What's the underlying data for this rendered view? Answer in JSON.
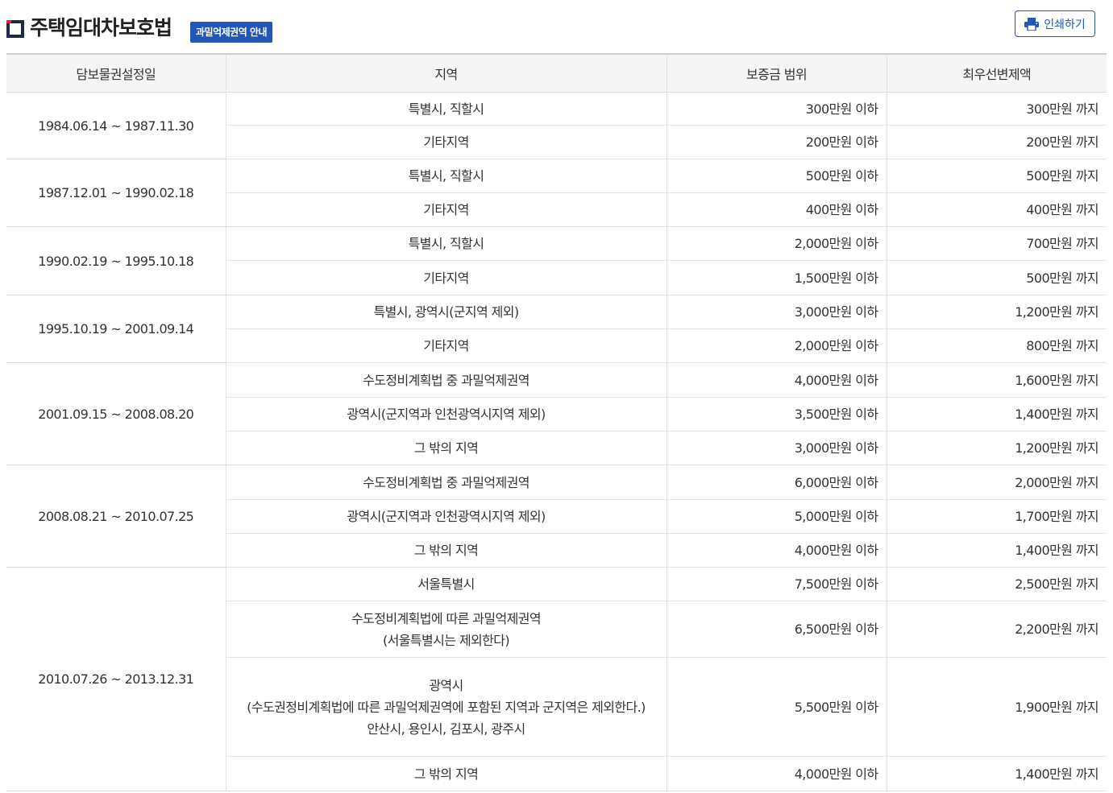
{
  "header": {
    "title": "주택임대차보호법",
    "badge": "과밀억제권역 안내",
    "print_label": "인쇄하기",
    "accent_color": "#2456b8"
  },
  "table": {
    "columns": [
      "담보물권설정일",
      "지역",
      "보증금 범위",
      "최우선변제액"
    ],
    "groups": [
      {
        "period": "1984.06.14 ~ 1987.11.30",
        "rows": [
          {
            "region": [
              "특별시, 직할시"
            ],
            "deposit": "300만원 이하",
            "priority": "300만원 까지"
          },
          {
            "region": [
              "기타지역"
            ],
            "deposit": "200만원 이하",
            "priority": "200만원 까지"
          }
        ]
      },
      {
        "period": "1987.12.01 ~ 1990.02.18",
        "rows": [
          {
            "region": [
              "특별시, 직할시"
            ],
            "deposit": "500만원 이하",
            "priority": "500만원 까지"
          },
          {
            "region": [
              "기타지역"
            ],
            "deposit": "400만원 이하",
            "priority": "400만원 까지"
          }
        ]
      },
      {
        "period": "1990.02.19 ~ 1995.10.18",
        "rows": [
          {
            "region": [
              "특별시, 직할시"
            ],
            "deposit": "2,000만원 이하",
            "priority": "700만원 까지"
          },
          {
            "region": [
              "기타지역"
            ],
            "deposit": "1,500만원 이하",
            "priority": "500만원 까지"
          }
        ]
      },
      {
        "period": "1995.10.19 ~ 2001.09.14",
        "rows": [
          {
            "region": [
              "특별시, 광역시(군지역 제외)"
            ],
            "deposit": "3,000만원 이하",
            "priority": "1,200만원 까지"
          },
          {
            "region": [
              "기타지역"
            ],
            "deposit": "2,000만원 이하",
            "priority": "800만원 까지"
          }
        ]
      },
      {
        "period": "2001.09.15 ~ 2008.08.20",
        "rows": [
          {
            "region": [
              "수도정비계획법 중 과밀억제권역"
            ],
            "deposit": "4,000만원 이하",
            "priority": "1,600만원 까지"
          },
          {
            "region": [
              "광역시(군지역과 인천광역시지역 제외)"
            ],
            "deposit": "3,500만원 이하",
            "priority": "1,400만원 까지"
          },
          {
            "region": [
              "그 밖의 지역"
            ],
            "deposit": "3,000만원 이하",
            "priority": "1,200만원 까지"
          }
        ]
      },
      {
        "period": "2008.08.21 ~ 2010.07.25",
        "rows": [
          {
            "region": [
              "수도정비계획법 중 과밀억제권역"
            ],
            "deposit": "6,000만원 이하",
            "priority": "2,000만원 까지"
          },
          {
            "region": [
              "광역시(군지역과 인천광역시지역 제외)"
            ],
            "deposit": "5,000만원 이하",
            "priority": "1,700만원 까지"
          },
          {
            "region": [
              "그 밖의 지역"
            ],
            "deposit": "4,000만원 이하",
            "priority": "1,400만원 까지"
          }
        ]
      },
      {
        "period": "2010.07.26 ~ 2013.12.31",
        "rows": [
          {
            "region": [
              "서울특별시"
            ],
            "deposit": "7,500만원 이하",
            "priority": "2,500만원 까지"
          },
          {
            "region": [
              "수도정비계획법에 따른 과밀억제권역",
              "(서울특별시는 제외한다)"
            ],
            "deposit": "6,500만원 이하",
            "priority": "2,200만원 까지"
          },
          {
            "region": [
              "광역시",
              "(수도권정비계획법에 따른 과밀억제권역에 포함된 지역과 군지역은 제외한다.)",
              "안산시, 용인시, 김포시, 광주시"
            ],
            "deposit": "5,500만원 이하",
            "priority": "1,900만원 까지"
          },
          {
            "region": [
              "그 밖의 지역"
            ],
            "deposit": "4,000만원 이하",
            "priority": "1,400만원 까지"
          }
        ]
      }
    ]
  }
}
